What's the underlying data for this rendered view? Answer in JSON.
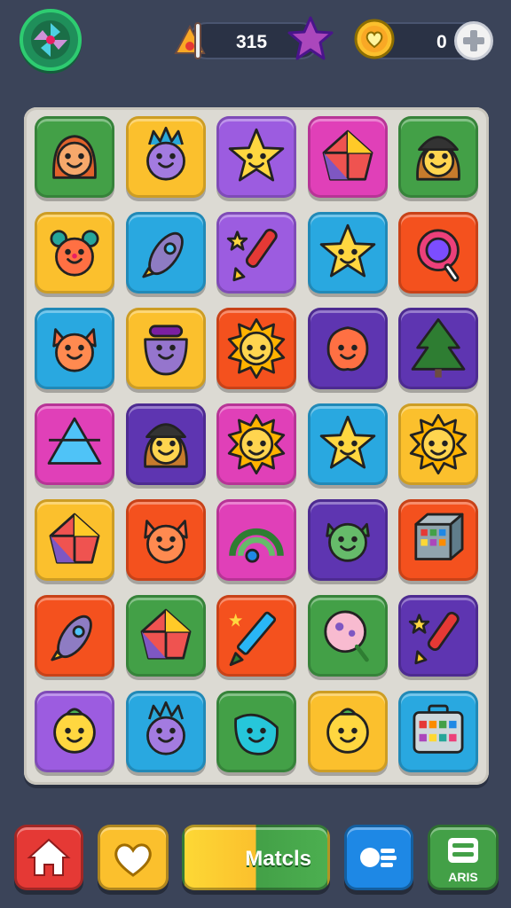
{
  "header": {
    "score_value": "315",
    "coins_value": "0"
  },
  "footer": {
    "match_label": "Matcls",
    "list_label": "ARIS"
  },
  "colors": {
    "green": "#43a047",
    "yellow": "#fbc02d",
    "purple": "#9c5ce0",
    "magenta": "#e040b8",
    "orange": "#f4511e",
    "blue": "#29a8e0",
    "violet": "#5e35b1"
  },
  "board": {
    "rows": [
      [
        {
          "icon": "girl-face-icon",
          "color": "green"
        },
        {
          "icon": "monster-face-icon",
          "color": "yellow"
        },
        {
          "icon": "star-face-icon",
          "color": "purple"
        },
        {
          "icon": "kite-icon",
          "color": "magenta"
        },
        {
          "icon": "hat-girl-icon",
          "color": "green"
        }
      ],
      [
        {
          "icon": "clown-face-icon",
          "color": "yellow"
        },
        {
          "icon": "rocket-icon",
          "color": "blue"
        },
        {
          "icon": "paintbrush-icon",
          "color": "purple"
        },
        {
          "icon": "star-face-icon",
          "color": "blue"
        },
        {
          "icon": "lollipop-icon",
          "color": "orange"
        }
      ],
      [
        {
          "icon": "cat-face-icon",
          "color": "blue"
        },
        {
          "icon": "pot-face-icon",
          "color": "yellow"
        },
        {
          "icon": "sun-face-icon",
          "color": "orange"
        },
        {
          "icon": "fish-face-icon",
          "color": "violet"
        },
        {
          "icon": "tree-icon",
          "color": "violet"
        }
      ],
      [
        {
          "icon": "triangle-face-icon",
          "color": "magenta"
        },
        {
          "icon": "hat-girl-icon",
          "color": "violet"
        },
        {
          "icon": "sun-face-icon",
          "color": "magenta"
        },
        {
          "icon": "star-face-icon",
          "color": "blue"
        },
        {
          "icon": "sun-face-icon",
          "color": "yellow"
        }
      ],
      [
        {
          "icon": "kite-icon",
          "color": "yellow"
        },
        {
          "icon": "cat-face-icon",
          "color": "orange"
        },
        {
          "icon": "rainbow-icon",
          "color": "magenta"
        },
        {
          "icon": "alien-face-icon",
          "color": "violet"
        },
        {
          "icon": "cube-icon",
          "color": "orange"
        }
      ],
      [
        {
          "icon": "rocket-icon",
          "color": "orange"
        },
        {
          "icon": "kite-icon",
          "color": "green"
        },
        {
          "icon": "crayon-icon",
          "color": "orange"
        },
        {
          "icon": "balloon-icon",
          "color": "green"
        },
        {
          "icon": "paintbrush-icon",
          "color": "violet"
        }
      ],
      [
        {
          "icon": "smiley-face-icon",
          "color": "purple"
        },
        {
          "icon": "monster-face-icon",
          "color": "blue"
        },
        {
          "icon": "drop-face-icon",
          "color": "green"
        },
        {
          "icon": "smiley-face-icon",
          "color": "yellow"
        },
        {
          "icon": "toolbox-icon",
          "color": "blue"
        }
      ]
    ]
  }
}
